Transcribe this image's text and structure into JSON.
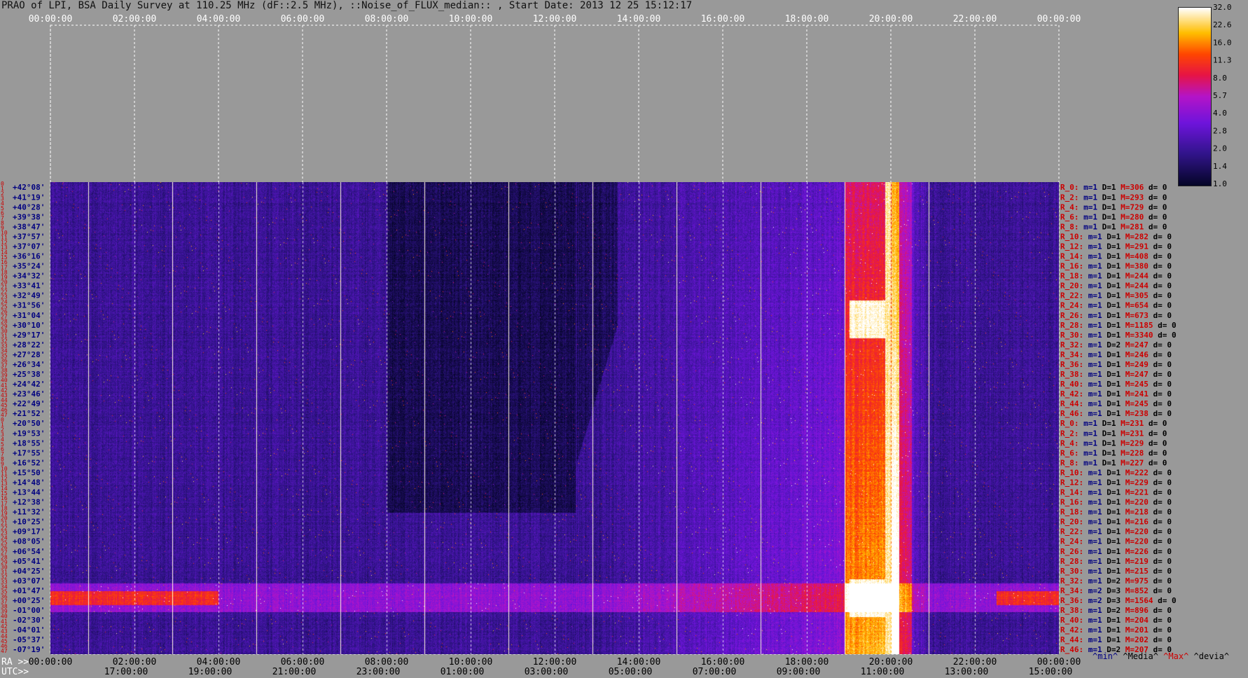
{
  "title": "PRAO of LPI, BSA Daily Survey at 110.25 MHz (dF::2.5 MHz), ::Noise_of_FLUX_median:: , Start Date: 2013 12 25 15:12:17",
  "axis_labels": {
    "ra_prefix": "RA >>",
    "utc_prefix": "UTC>>"
  },
  "legend": {
    "min": "^min^",
    "median": "^Media^",
    "max": "^Max^",
    "devia": "^devia^"
  },
  "chart_data": {
    "type": "heatmap",
    "x_top_ticks": [
      "00:00:00",
      "02:00:00",
      "04:00:00",
      "06:00:00",
      "08:00:00",
      "10:00:00",
      "12:00:00",
      "14:00:00",
      "16:00:00",
      "18:00:00",
      "20:00:00",
      "22:00:00",
      "00:00:00"
    ],
    "x_ra_ticks": [
      "00:00:00",
      "02:00:00",
      "04:00:00",
      "06:00:00",
      "08:00:00",
      "10:00:00",
      "12:00:00",
      "14:00:00",
      "16:00:00",
      "18:00:00",
      "20:00:00",
      "22:00:00",
      "00:00:00"
    ],
    "x_utc_ticks": [
      "17:00:00",
      "19:00:00",
      "21:00:00",
      "23:00:00",
      "01:00:00",
      "03:00:00",
      "05:00:00",
      "07:00:00",
      "09:00:00",
      "11:00:00",
      "13:00:00",
      "15:00:00"
    ],
    "row_numbers": [
      "0",
      "1",
      "2",
      "3",
      "4",
      "5",
      "6",
      "7",
      "8",
      "9",
      "10",
      "11",
      "12",
      "13",
      "14",
      "15",
      "16",
      "17",
      "18",
      "19",
      "20",
      "21",
      "22",
      "23",
      "24",
      "25",
      "26",
      "27",
      "28",
      "29",
      "30",
      "31",
      "32",
      "33",
      "34",
      "35",
      "36",
      "37",
      "38",
      "39",
      "40",
      "41",
      "42",
      "43",
      "44",
      "45",
      "46",
      "47",
      "0",
      "1",
      "2",
      "3",
      "4",
      "5",
      "6",
      "7",
      "8",
      "9",
      "10",
      "11",
      "12",
      "13",
      "14",
      "15",
      "16",
      "17",
      "18",
      "19",
      "20",
      "21",
      "22",
      "23",
      "24",
      "25",
      "26",
      "27",
      "28",
      "29",
      "30",
      "31",
      "32",
      "33",
      "34",
      "35",
      "36",
      "37",
      "38",
      "39",
      "40",
      "41",
      "42",
      "43",
      "44",
      "45",
      "46",
      "47"
    ],
    "dec_labels": [
      "+42°08'",
      "+41°19'",
      "+40°28'",
      "+39°38'",
      "+38°47'",
      "+37°57'",
      "+37°07'",
      "+36°16'",
      "+35°24'",
      "+34°32'",
      "+33°41'",
      "+32°49'",
      "+31°56'",
      "+31°04'",
      "+30°10'",
      "+29°17'",
      "+28°22'",
      "+27°28'",
      "+26°34'",
      "+25°38'",
      "+24°42'",
      "+23°46'",
      "+22°49'",
      "+21°52'",
      "+20°50'",
      "+19°53'",
      "+18°55'",
      "+17°55'",
      "+16°52'",
      "+15°50'",
      "+14°48'",
      "+13°44'",
      "+12°38'",
      "+11°32'",
      "+10°25'",
      "+09°17'",
      "+08°05'",
      "+06°54'",
      "+05°41'",
      "+04°25'",
      "+03°07'",
      "+01°47'",
      "+00°25'",
      "-01°00'",
      "-02°30'",
      "-04°01'",
      "-05°37'",
      "-07°19'"
    ],
    "colorbar_ticks": [
      "32.0",
      "22.6",
      "16.0",
      "11.3",
      "8.0",
      "5.7",
      "4.0",
      "2.8",
      "2.0",
      "1.4",
      "1.0"
    ],
    "beam_stats": [
      {
        "r": "R_0:",
        "m": "m=1",
        "D": "D=1",
        "M": "M=306",
        "d": "d= 0"
      },
      {
        "r": "R_2:",
        "m": "m=1",
        "D": "D=1",
        "M": "M=293",
        "d": "d= 0"
      },
      {
        "r": "R_4:",
        "m": "m=1",
        "D": "D=1",
        "M": "M=729",
        "d": "d= 0"
      },
      {
        "r": "R_6:",
        "m": "m=1",
        "D": "D=1",
        "M": "M=280",
        "d": "d= 0"
      },
      {
        "r": "R_8:",
        "m": "m=1",
        "D": "D=1",
        "M": "M=281",
        "d": "d= 0"
      },
      {
        "r": "R_10:",
        "m": "m=1",
        "D": "D=1",
        "M": "M=282",
        "d": "d= 0"
      },
      {
        "r": "R_12:",
        "m": "m=1",
        "D": "D=1",
        "M": "M=291",
        "d": "d= 0"
      },
      {
        "r": "R_14:",
        "m": "m=1",
        "D": "D=1",
        "M": "M=408",
        "d": "d= 0"
      },
      {
        "r": "R_16:",
        "m": "m=1",
        "D": "D=1",
        "M": "M=380",
        "d": "d= 0"
      },
      {
        "r": "R_18:",
        "m": "m=1",
        "D": "D=1",
        "M": "M=244",
        "d": "d= 0"
      },
      {
        "r": "R_20:",
        "m": "m=1",
        "D": "D=1",
        "M": "M=244",
        "d": "d= 0"
      },
      {
        "r": "R_22:",
        "m": "m=1",
        "D": "D=1",
        "M": "M=305",
        "d": "d= 0"
      },
      {
        "r": "R_24:",
        "m": "m=1",
        "D": "D=1",
        "M": "M=654",
        "d": "d= 0"
      },
      {
        "r": "R_26:",
        "m": "m=1",
        "D": "D=1",
        "M": "M=673",
        "d": "d= 0"
      },
      {
        "r": "R_28:",
        "m": "m=1",
        "D": "D=1",
        "M": "M=1185",
        "d": "d= 0"
      },
      {
        "r": "R_30:",
        "m": "m=1",
        "D": "D=1",
        "M": "M=3340",
        "d": "d= 0"
      },
      {
        "r": "R_32:",
        "m": "m=1",
        "D": "D=2",
        "M": "M=247",
        "d": "d= 0"
      },
      {
        "r": "R_34:",
        "m": "m=1",
        "D": "D=1",
        "M": "M=246",
        "d": "d= 0"
      },
      {
        "r": "R_36:",
        "m": "m=1",
        "D": "D=1",
        "M": "M=249",
        "d": "d= 0"
      },
      {
        "r": "R_38:",
        "m": "m=1",
        "D": "D=1",
        "M": "M=247",
        "d": "d= 0"
      },
      {
        "r": "R_40:",
        "m": "m=1",
        "D": "D=1",
        "M": "M=245",
        "d": "d= 0"
      },
      {
        "r": "R_42:",
        "m": "m=1",
        "D": "D=1",
        "M": "M=241",
        "d": "d= 0"
      },
      {
        "r": "R_44:",
        "m": "m=1",
        "D": "D=1",
        "M": "M=245",
        "d": "d= 0"
      },
      {
        "r": "R_46:",
        "m": "m=1",
        "D": "D=1",
        "M": "M=238",
        "d": "d= 0"
      },
      {
        "r": "R_0:",
        "m": "m=1",
        "D": "D=1",
        "M": "M=231",
        "d": "d= 0"
      },
      {
        "r": "R_2:",
        "m": "m=1",
        "D": "D=1",
        "M": "M=231",
        "d": "d= 0"
      },
      {
        "r": "R_4:",
        "m": "m=1",
        "D": "D=1",
        "M": "M=229",
        "d": "d= 0"
      },
      {
        "r": "R_6:",
        "m": "m=1",
        "D": "D=1",
        "M": "M=228",
        "d": "d= 0"
      },
      {
        "r": "R_8:",
        "m": "m=1",
        "D": "D=1",
        "M": "M=227",
        "d": "d= 0"
      },
      {
        "r": "R_10:",
        "m": "m=1",
        "D": "D=1",
        "M": "M=222",
        "d": "d= 0"
      },
      {
        "r": "R_12:",
        "m": "m=1",
        "D": "D=1",
        "M": "M=229",
        "d": "d= 0"
      },
      {
        "r": "R_14:",
        "m": "m=1",
        "D": "D=1",
        "M": "M=221",
        "d": "d= 0"
      },
      {
        "r": "R_16:",
        "m": "m=1",
        "D": "D=1",
        "M": "M=220",
        "d": "d= 0"
      },
      {
        "r": "R_18:",
        "m": "m=1",
        "D": "D=1",
        "M": "M=218",
        "d": "d= 0"
      },
      {
        "r": "R_20:",
        "m": "m=1",
        "D": "D=1",
        "M": "M=216",
        "d": "d= 0"
      },
      {
        "r": "R_22:",
        "m": "m=1",
        "D": "D=1",
        "M": "M=220",
        "d": "d= 0"
      },
      {
        "r": "R_24:",
        "m": "m=1",
        "D": "D=1",
        "M": "M=220",
        "d": "d= 0"
      },
      {
        "r": "R_26:",
        "m": "m=1",
        "D": "D=1",
        "M": "M=226",
        "d": "d= 0"
      },
      {
        "r": "R_28:",
        "m": "m=1",
        "D": "D=1",
        "M": "M=219",
        "d": "d= 0"
      },
      {
        "r": "R_30:",
        "m": "m=1",
        "D": "D=1",
        "M": "M=215",
        "d": "d= 0"
      },
      {
        "r": "R_32:",
        "m": "m=1",
        "D": "D=2",
        "M": "M=975",
        "d": "d= 0"
      },
      {
        "r": "R_34:",
        "m": "m=2",
        "D": "D=3",
        "M": "M=852",
        "d": "d= 0"
      },
      {
        "r": "R_36:",
        "m": "m=2",
        "D": "D=3",
        "M": "M=1564",
        "d": "d= 0"
      },
      {
        "r": "R_38:",
        "m": "m=1",
        "D": "D=2",
        "M": "M=896",
        "d": "d= 0"
      },
      {
        "r": "R_40:",
        "m": "m=1",
        "D": "D=1",
        "M": "M=204",
        "d": "d= 0"
      },
      {
        "r": "R_42:",
        "m": "m=1",
        "D": "D=1",
        "M": "M=201",
        "d": "d= 0"
      },
      {
        "r": "R_44:",
        "m": "m=1",
        "D": "D=1",
        "M": "M=202",
        "d": "d= 0"
      },
      {
        "r": "R_46:",
        "m": "m=1",
        "D": "D=2",
        "M": "M=207",
        "d": "d= 0"
      }
    ],
    "colors": {
      "background": "#999999",
      "row_number": "#cc0000",
      "dec_label": "#000080",
      "stat_r": "#cc0000",
      "stat_m": "#000080",
      "stat_D": "#000000",
      "stat_M": "#cc0000",
      "stat_d": "#000000",
      "legend_min": "#000080",
      "legend_median": "#000000",
      "legend_max": "#cc0000",
      "legend_devia": "#000000"
    }
  }
}
